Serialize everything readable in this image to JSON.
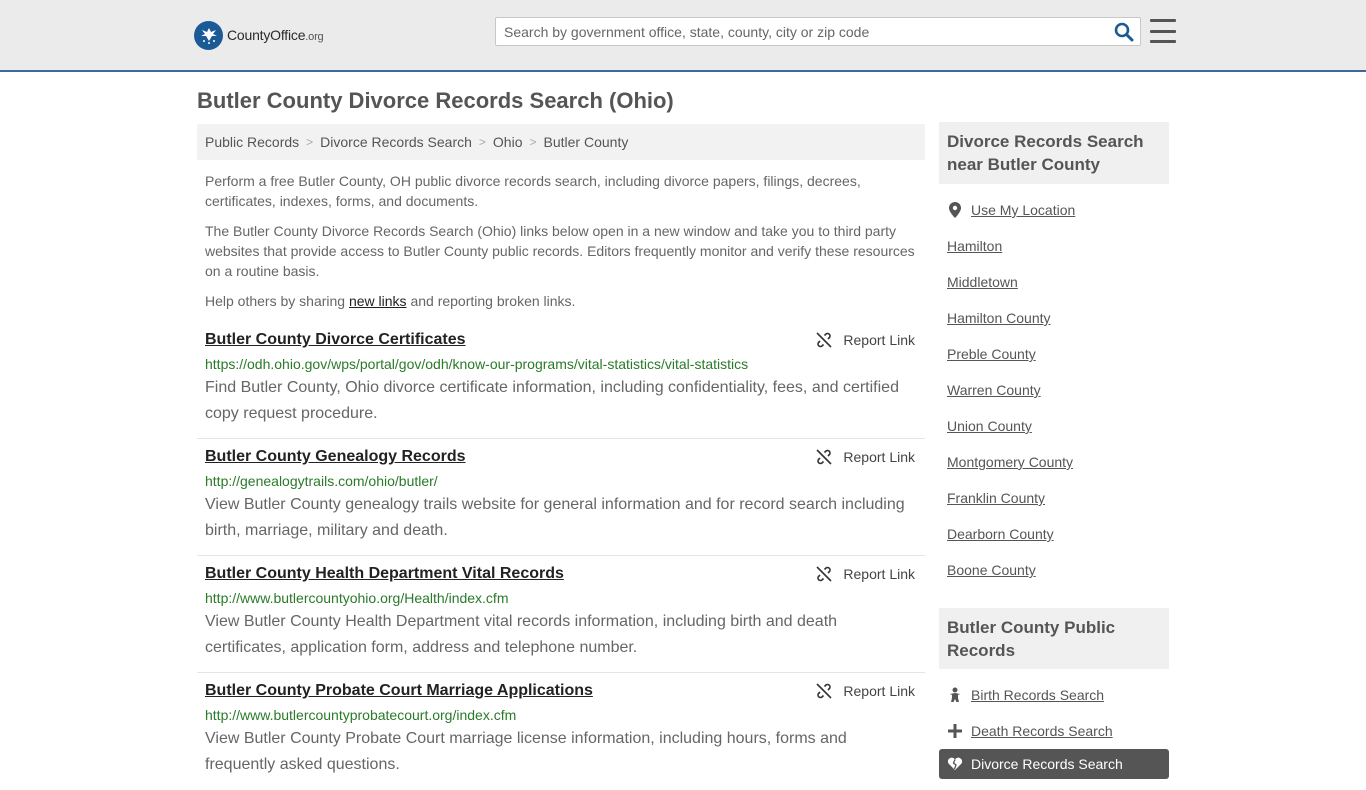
{
  "header": {
    "logo_main": "County",
    "logo_mid": "Office",
    "logo_tld": ".org",
    "search_placeholder": "Search by government office, state, county, city or zip code"
  },
  "page": {
    "title": "Butler County Divorce Records Search (Ohio)"
  },
  "breadcrumb": [
    "Public Records",
    "Divorce Records Search",
    "Ohio",
    "Butler County"
  ],
  "intro": {
    "p1": "Perform a free Butler County, OH public divorce records search, including divorce papers, filings, decrees, certificates, indexes, forms, and documents.",
    "p2": "The Butler County Divorce Records Search (Ohio) links below open in a new window and take you to third party websites that provide access to Butler County public records. Editors frequently monitor and verify these resources on a routine basis.",
    "p3_before": "Help others by sharing ",
    "p3_link": "new links",
    "p3_after": " and reporting broken links."
  },
  "report_label": "Report Link",
  "results": [
    {
      "title": "Butler County Divorce Certificates",
      "url": "https://odh.ohio.gov/wps/portal/gov/odh/know-our-programs/vital-statistics/vital-statistics",
      "desc": "Find Butler County, Ohio divorce certificate information, including confidentiality, fees, and certified copy request procedure."
    },
    {
      "title": "Butler County Genealogy Records",
      "url": "http://genealogytrails.com/ohio/butler/",
      "desc": "View Butler County genealogy trails website for general information and for record search including birth, marriage, military and death."
    },
    {
      "title": "Butler County Health Department Vital Records",
      "url": "http://www.butlercountyohio.org/Health/index.cfm",
      "desc": "View Butler County Health Department vital records information, including birth and death certificates, application form, address and telephone number."
    },
    {
      "title": "Butler County Probate Court Marriage Applications",
      "url": "http://www.butlercountyprobatecourt.org/index.cfm",
      "desc": "View Butler County Probate Court marriage license information, including hours, forms and frequently asked questions."
    }
  ],
  "sidebar": {
    "nearby_heading": "Divorce Records Search near Butler County",
    "use_location": "Use My Location",
    "nearby": [
      "Hamilton",
      "Middletown",
      "Hamilton County",
      "Preble County",
      "Warren County",
      "Union County",
      "Montgomery County",
      "Franklin County",
      "Dearborn County",
      "Boone County"
    ],
    "public_heading": "Butler County Public Records",
    "public_items": [
      "Birth Records Search",
      "Death Records Search"
    ],
    "active_item": "Divorce Records Search"
  }
}
